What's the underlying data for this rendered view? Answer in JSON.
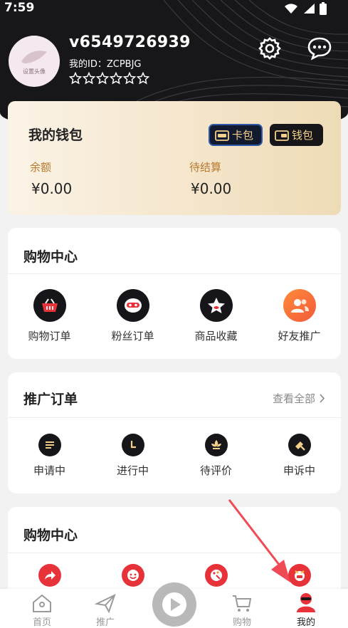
{
  "status": {
    "time": "7:59"
  },
  "profile": {
    "avatar_text": "设置头像",
    "username": "v6549726939",
    "user_id": "我的ID：ZCPBJG",
    "rating_stars": 6
  },
  "wallet": {
    "title": "我的钱包",
    "card_label": "卡包",
    "purse_label": "钱包",
    "balance_label": "余额",
    "balance_value": "¥0.00",
    "pending_label": "待结算",
    "pending_value": "¥0.00"
  },
  "shopping": {
    "title": "购物中心",
    "items": [
      {
        "label": "购物订单",
        "icon": "basket-icon"
      },
      {
        "label": "粉丝订单",
        "icon": "robot-icon"
      },
      {
        "label": "商品收藏",
        "icon": "star-icon"
      },
      {
        "label": "好友推广",
        "icon": "friends-icon"
      }
    ]
  },
  "promo": {
    "title": "推广订单",
    "view_all": "查看全部",
    "items": [
      {
        "label": "申请中",
        "icon": "list-icon"
      },
      {
        "label": "进行中",
        "icon": "clock-icon"
      },
      {
        "label": "待评价",
        "icon": "flower-icon"
      },
      {
        "label": "申诉中",
        "icon": "hammer-icon"
      }
    ]
  },
  "shopping2": {
    "title": "购物中心"
  },
  "tabbar": {
    "items": [
      {
        "label": "首页",
        "icon": "home-icon"
      },
      {
        "label": "推广",
        "icon": "paper-plane-icon"
      },
      {
        "label": "购物",
        "icon": "cart-icon"
      },
      {
        "label": "我的",
        "icon": "user-icon"
      }
    ]
  },
  "colors": {
    "header_bg": "#17171a",
    "accent_red": "#e8323a",
    "gold": "#b87a2e"
  }
}
